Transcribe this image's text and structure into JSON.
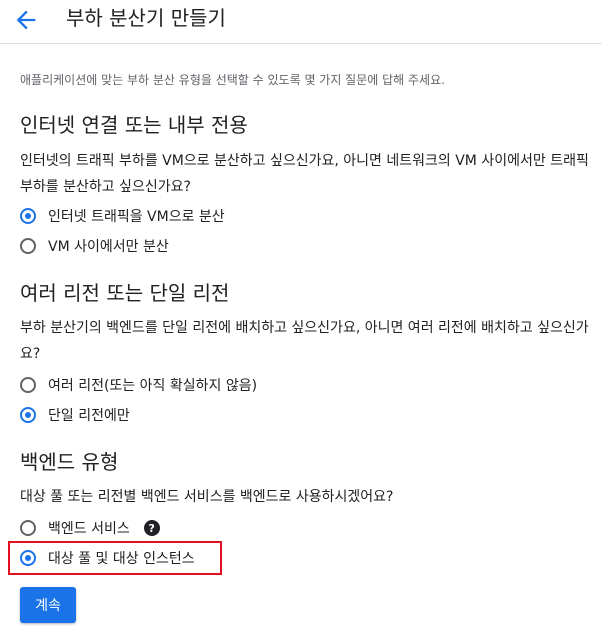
{
  "header": {
    "title": "부하 분산기 만들기"
  },
  "intro": "애플리케이션에 맞는 부하 분산 유형을 선택할 수 있도록 몇 가지 질문에 답해 주세요.",
  "sections": [
    {
      "title": "인터넷 연결 또는 내부 전용",
      "question": "인터넷의 트래픽 부하를 VM으로 분산하고 싶으신가요, 아니면 네트워크의 VM 사이에서만 트래픽 부하를 분산하고 싶으신가요?",
      "options": [
        {
          "label": "인터넷 트래픽을 VM으로 분산",
          "selected": true
        },
        {
          "label": "VM 사이에서만 분산",
          "selected": false
        }
      ]
    },
    {
      "title": "여러 리전 또는 단일 리전",
      "question": "부하 분산기의 백엔드를 단일 리전에 배치하고 싶으신가요, 아니면 여러 리전에 배치하고 싶으신가요?",
      "options": [
        {
          "label": "여러 리전(또는 아직 확실하지 않음)",
          "selected": false
        },
        {
          "label": "단일 리전에만",
          "selected": true
        }
      ]
    },
    {
      "title": "백엔드 유형",
      "question": "대상 풀 또는 리전별 백엔드 서비스를 백엔드로 사용하시겠어요?",
      "options": [
        {
          "label": "백엔드 서비스",
          "selected": false,
          "help_icon": "?"
        },
        {
          "label": "대상 풀 및 대상 인스턴스",
          "selected": true
        }
      ]
    }
  ],
  "continue_label": "계속",
  "colors": {
    "accent": "#1a73e8",
    "highlight": "#e0101e"
  }
}
